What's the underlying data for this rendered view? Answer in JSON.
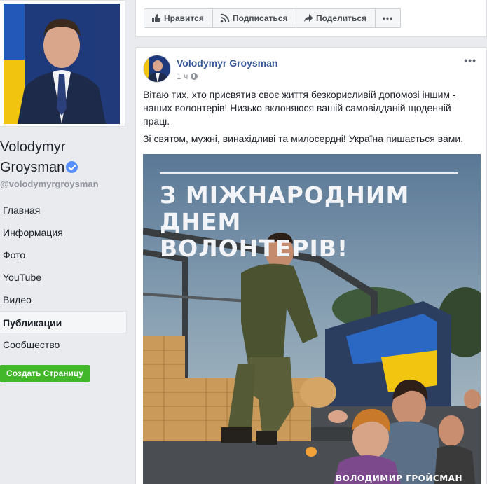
{
  "profile": {
    "name_first": "Volodymyr",
    "name_last": "Groysman",
    "handle": "@volodymyrgroysman",
    "verified_icon": "verified-badge-icon"
  },
  "nav": {
    "items": [
      {
        "label": "Главная",
        "active": false
      },
      {
        "label": "Информация",
        "active": false
      },
      {
        "label": "Фото",
        "active": false
      },
      {
        "label": "YouTube",
        "active": false
      },
      {
        "label": "Видео",
        "active": false
      },
      {
        "label": "Публикации",
        "active": true
      },
      {
        "label": "Сообщество",
        "active": false
      }
    ],
    "create_page_label": "Создать Страницу"
  },
  "actions": {
    "like_label": "Нравится",
    "subscribe_label": "Подписаться",
    "share_label": "Поделиться",
    "more_label": "•••"
  },
  "post": {
    "author": "Volodymyr Groysman",
    "time": "1 ч",
    "audience_icon": "globe-icon",
    "menu_label": "•••",
    "text_p1": "Вітаю тих, хто присвятив своє життя безкорисливій допомозі іншим - наших волонтерів! Низько вклоняюся вашій самовідданій щоденній праці.",
    "text_p2": "Зі святом, мужні, винахідливі та милосердні! Україна пишається вами.",
    "image": {
      "headline_line1": "З МІЖНАРОДНИМ ДНЕМ",
      "headline_line2": "ВОЛОНТЕРІВ!",
      "signature": "ВОЛОДИМИР ГРОЙСМАН"
    }
  },
  "colors": {
    "link": "#365899",
    "accent_green": "#42b72a",
    "background": "#e9ebee",
    "verified": "#5890ff"
  }
}
